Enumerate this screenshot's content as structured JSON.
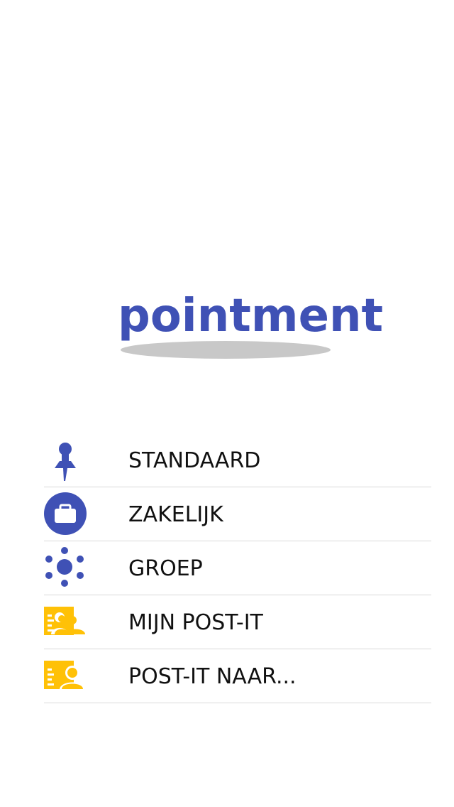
{
  "app": {
    "logo_text": "pointment"
  },
  "colors": {
    "brand_blue": "#3f51b5",
    "accent_yellow": "#ffc107",
    "shadow_gray": "#c8c8c8",
    "divider": "#d9d9d9"
  },
  "menu": {
    "items": [
      {
        "label": "STANDAARD",
        "icon": "pushpin-icon"
      },
      {
        "label": "ZAKELIJK",
        "icon": "briefcase-icon"
      },
      {
        "label": "GROEP",
        "icon": "group-icon"
      },
      {
        "label": "MIJN POST-IT",
        "icon": "contacts-card-icon"
      },
      {
        "label": "POST-IT NAAR...",
        "icon": "contact-card-icon"
      }
    ]
  }
}
